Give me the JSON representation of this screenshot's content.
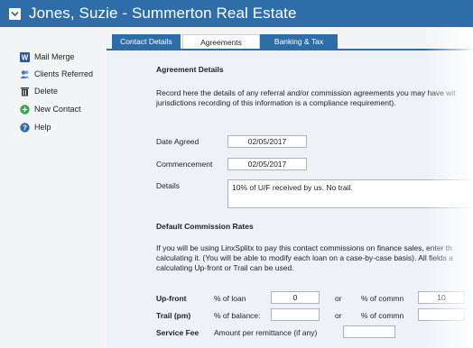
{
  "window": {
    "title": "Jones, Suzie - Summerton Real Estate"
  },
  "sidebar": {
    "items": [
      {
        "label": "Mail Merge",
        "icon": "word-icon"
      },
      {
        "label": "Clients Referred",
        "icon": "people-icon"
      },
      {
        "label": "Delete",
        "icon": "trash-icon"
      },
      {
        "label": "New Contact",
        "icon": "add-icon"
      },
      {
        "label": "Help",
        "icon": "help-icon"
      }
    ]
  },
  "tabs": [
    {
      "label": "Contact Details",
      "active": false
    },
    {
      "label": "Agreements",
      "active": true
    },
    {
      "label": "Banking & Tax",
      "active": false
    }
  ],
  "agreement": {
    "heading": "Agreement Details",
    "desc_line1": "Record here the details of any referral and/or commission agreements you may have wit",
    "desc_line2": "jurisdictions recording of this information is a compliance requirement).",
    "date_agreed_label": "Date Agreed",
    "date_agreed_value": "02/05/2017",
    "commencement_label": "Commencement",
    "commencement_value": "02/05/2017",
    "details_label": "Details",
    "details_value": "10% of U/F received by us. No trail."
  },
  "commission": {
    "heading": "Default Commission Rates",
    "desc_line1": "If you will be using LinxSplitx to pay this contact commissions on finance sales, enter th",
    "desc_line2": "calculating it. (You will be able to modify each loan on a case-by-case basis). All fields a",
    "desc_line3": "calculating Up-front or Trail can be used.",
    "upfront_label": "Up-front",
    "upfront_loan_label": "% of loan",
    "upfront_loan_value": "0",
    "or1": "or",
    "upfront_commn_label": "% of commn",
    "upfront_commn_value": "10",
    "trail_label": "Trail (pm)",
    "trail_balance_label": "% of balance:",
    "trail_balance_value": "",
    "or2": "or",
    "trail_commn_label": "% of commn",
    "trail_commn_value": "",
    "service_fee_label": "Service Fee",
    "service_fee_desc": "Amount per remittance (if any)",
    "service_fee_value": ""
  },
  "colors": {
    "accent": "#2f6da8",
    "content_bg": "#eef2f7",
    "sidebar_bg": "#f3f4f6"
  }
}
